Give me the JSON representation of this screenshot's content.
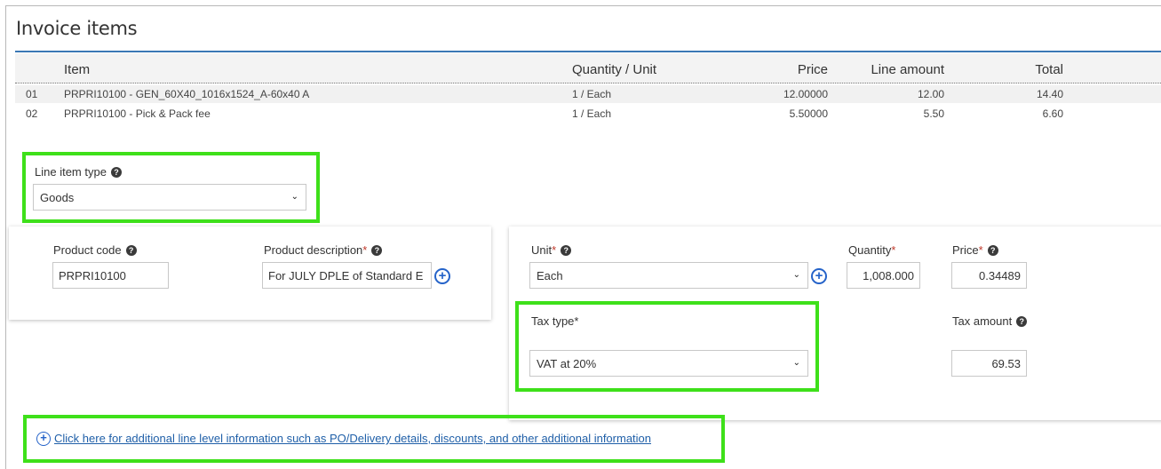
{
  "section": {
    "title": "Invoice items"
  },
  "table": {
    "headers": {
      "item": "Item",
      "qty_unit": "Quantity / Unit",
      "price": "Price",
      "line_amount": "Line amount",
      "total": "Total"
    },
    "rows": [
      {
        "num": "01",
        "item": "PRPRI10100 - GEN_60X40_1016x1524_A-60x40 A",
        "qty_unit": "1 / Each",
        "price": "12.00000",
        "line_amount": "12.00",
        "total": "14.40"
      },
      {
        "num": "02",
        "item": "PRPRI10100 - Pick & Pack fee",
        "qty_unit": "1 / Each",
        "price": "5.50000",
        "line_amount": "5.50",
        "total": "6.60"
      }
    ]
  },
  "line_item_type": {
    "label": "Line item type",
    "value": "Goods"
  },
  "product": {
    "code_label": "Product code",
    "code_value": "PRPRI10100",
    "desc_label": "Product description",
    "desc_required": "*",
    "desc_value": "For JULY DPLE of Standard E"
  },
  "pricing": {
    "unit_label": "Unit",
    "unit_required": "*",
    "unit_value": "Each",
    "qty_label": "Quantity",
    "qty_required": "*",
    "qty_value": "1,008.000",
    "price_label": "Price",
    "price_required": "*",
    "price_value": "0.34489",
    "tax_type_label": "Tax type",
    "tax_type_required": "*",
    "tax_type_value": "VAT at 20%",
    "tax_amount_label": "Tax amount",
    "tax_amount_value": "69.53"
  },
  "additional_link": {
    "text": "Click here for additional line level information such as PO/Delivery details, discounts, and other additional information"
  },
  "icons": {
    "help": "?",
    "plus": "+",
    "chevron": "⌄"
  },
  "colors": {
    "accent_rule": "#3b78b5",
    "highlight": "#3ee01a",
    "link": "#1f5fa8",
    "required": "#c0392b"
  }
}
